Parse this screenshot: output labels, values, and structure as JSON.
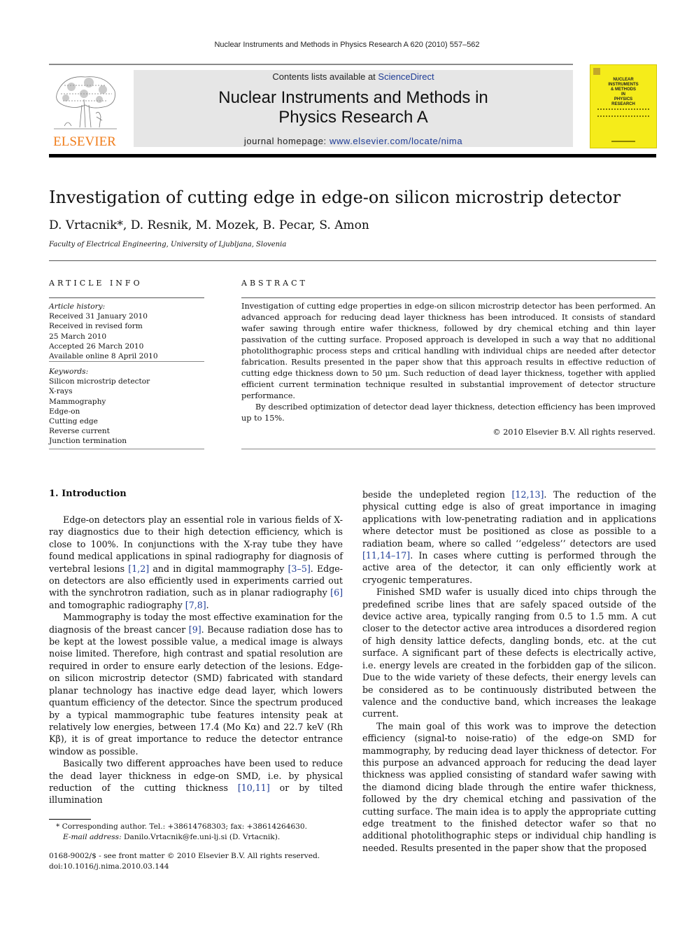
{
  "running_head": "Nuclear Instruments and Methods in Physics Research A 620 (2010) 557–562",
  "publisher": {
    "logo_text": "ELSEVIER",
    "logo_color": "#f07d1b"
  },
  "banner": {
    "contents_prefix": "Contents lists available at ",
    "contents_link": "ScienceDirect",
    "journal_title_line1": "Nuclear Instruments and Methods in",
    "journal_title_line2": "Physics Research A",
    "homepage_prefix": "journal homepage: ",
    "homepage_link": "www.elsevier.com/locate/nima",
    "link_color": "#1e3c96",
    "background": "#e6e6e6"
  },
  "cover": {
    "title_lines": [
      "NUCLEAR",
      "INSTRUMENTS",
      "& METHODS",
      "IN",
      "PHYSICS",
      "RESEARCH"
    ],
    "color": "#f5ec1a"
  },
  "article": {
    "title": "Investigation of cutting edge in edge-on silicon microstrip detector",
    "authors": "D. Vrtacnik*, D. Resnik, M. Mozek, B. Pecar, S. Amon",
    "affiliation": "Faculty of Electrical Engineering, University of Ljubljana, Slovenia"
  },
  "article_info": {
    "heading": "ARTICLE INFO",
    "history_label": "Article history:",
    "history": [
      "Received 31 January 2010",
      "Received in revised form",
      "25 March 2010",
      "Accepted 26 March 2010",
      "Available online 8 April 2010"
    ],
    "keywords_label": "Keywords:",
    "keywords": [
      "Silicon microstrip detector",
      "X-rays",
      "Mammography",
      "Edge-on",
      "Cutting edge",
      "Reverse current",
      "Junction termination"
    ]
  },
  "abstract": {
    "heading": "ABSTRACT",
    "paragraph1": "Investigation of cutting edge properties in edge-on silicon microstrip detector has been performed. An advanced approach for reducing dead layer thickness has been introduced. It consists of standard wafer sawing through entire wafer thickness, followed by dry chemical etching and thin layer passivation of the cutting surface. Proposed approach is developed in such a way that no additional photolithographic process steps and critical handling with individual chips are needed after detector fabrication. Results presented in the paper show that this approach results in effective reduction of cutting edge thickness down to 50 μm. Such reduction of dead layer thickness, together with applied efficient current termination technique resulted in substantial improvement of detector structure performance.",
    "paragraph2": "By described optimization of detector dead layer thickness, detection efficiency has been improved up to 15%.",
    "copyright": "© 2010 Elsevier B.V. All rights reserved."
  },
  "introduction": {
    "heading": "1.  Introduction",
    "left_column": [
      [
        {
          "t": "Edge-on detectors play an essential role in various fields of X-ray diagnostics due to their high detection efficiency, which is close to 100%. In conjunctions with the X-ray tube they have found medical applications in spinal radiography for diagnosis of vertebral lesions "
        },
        {
          "c": "[1,2]"
        },
        {
          "t": " and in digital mammography "
        },
        {
          "c": "[3–5]"
        },
        {
          "t": ". Edge-on detectors are also efficiently used in experiments carried out with the synchrotron radiation, such as in planar radiography "
        },
        {
          "c": "[6]"
        },
        {
          "t": " and tomographic radiography "
        },
        {
          "c": "[7,8]"
        },
        {
          "t": "."
        }
      ],
      [
        {
          "t": "Mammography is today the most effective examination for the diagnosis of the breast cancer "
        },
        {
          "c": "[9]"
        },
        {
          "t": ". Because radiation dose has to be kept at the lowest possible value, a medical image is always noise limited. Therefore, high contrast and spatial resolution are required in order to ensure early detection of the lesions. Edge-on silicon microstrip detector (SMD) fabricated with standard planar technology has inactive edge dead layer, which lowers quantum efficiency of the detector. Since the spectrum produced by a typical mammographic tube features intensity peak at relatively low energies, between 17.4 (Mo Kα) and 22.7 keV (Rh Kβ), it is of great importance to reduce the detector entrance window as possible."
        }
      ],
      [
        {
          "t": "Basically two different approaches have been used to reduce the dead layer thickness in edge-on SMD, i.e. by physical reduction of the cutting thickness "
        },
        {
          "c": "[10,11]"
        },
        {
          "t": " or by tilted illumination"
        }
      ]
    ],
    "right_column": [
      [
        {
          "t": "beside the undepleted region "
        },
        {
          "c": "[12,13]"
        },
        {
          "t": ". The reduction of the physical cutting edge is also of great importance in imaging applications with low-penetrating radiation and in applications where detector must be positioned as close as possible to a radiation beam, where so called ‘‘edgeless’’ detectors are used "
        },
        {
          "c": "[11,14–17]"
        },
        {
          "t": ". In cases where cutting is performed through the active area of the detector, it can only efficiently work at cryogenic temperatures."
        }
      ],
      [
        {
          "t": "Finished SMD wafer is usually diced into chips through the predefined scribe lines that are safely spaced outside of the device active area, typically ranging from 0.5 to 1.5 mm. A cut closer to the detector active area introduces a disordered region of high density lattice defects, dangling bonds, etc. at the cut surface. A significant part of these defects is electrically active, i.e. energy levels are created in the forbidden gap of the silicon. Due to the wide variety of these defects, their energy levels can be considered as to be continuously distributed between the valence and the conductive band, which increases the leakage current."
        }
      ],
      [
        {
          "t": "The main goal of this work was to improve the detection efficiency (signal-to noise-ratio) of the edge-on SMD for mammography, by reducing dead layer thickness of detector. For this purpose an advanced approach for reducing the dead layer thickness was applied consisting of standard wafer sawing with the diamond dicing blade through the entire wafer thickness, followed by the dry chemical etching and passivation of the cutting surface. The main idea is to apply the appropriate cutting edge treatment to the finished detector wafer so that no additional photolithographic steps or individual chip handling is needed. Results presented in the paper show that the proposed"
        }
      ]
    ]
  },
  "footnote": {
    "corresponding": "* Corresponding author. Tel.: +38614768303; fax: +38614264630.",
    "email_label": "E-mail address:",
    "email": " Danilo.Vrtacnik@fe.uni-lj.si (D. Vrtacnik)."
  },
  "front_matter": {
    "issn_line": "0168-9002/$ - see front matter © 2010 Elsevier B.V. All rights reserved.",
    "doi": "doi:10.1016/j.nima.2010.03.144"
  }
}
